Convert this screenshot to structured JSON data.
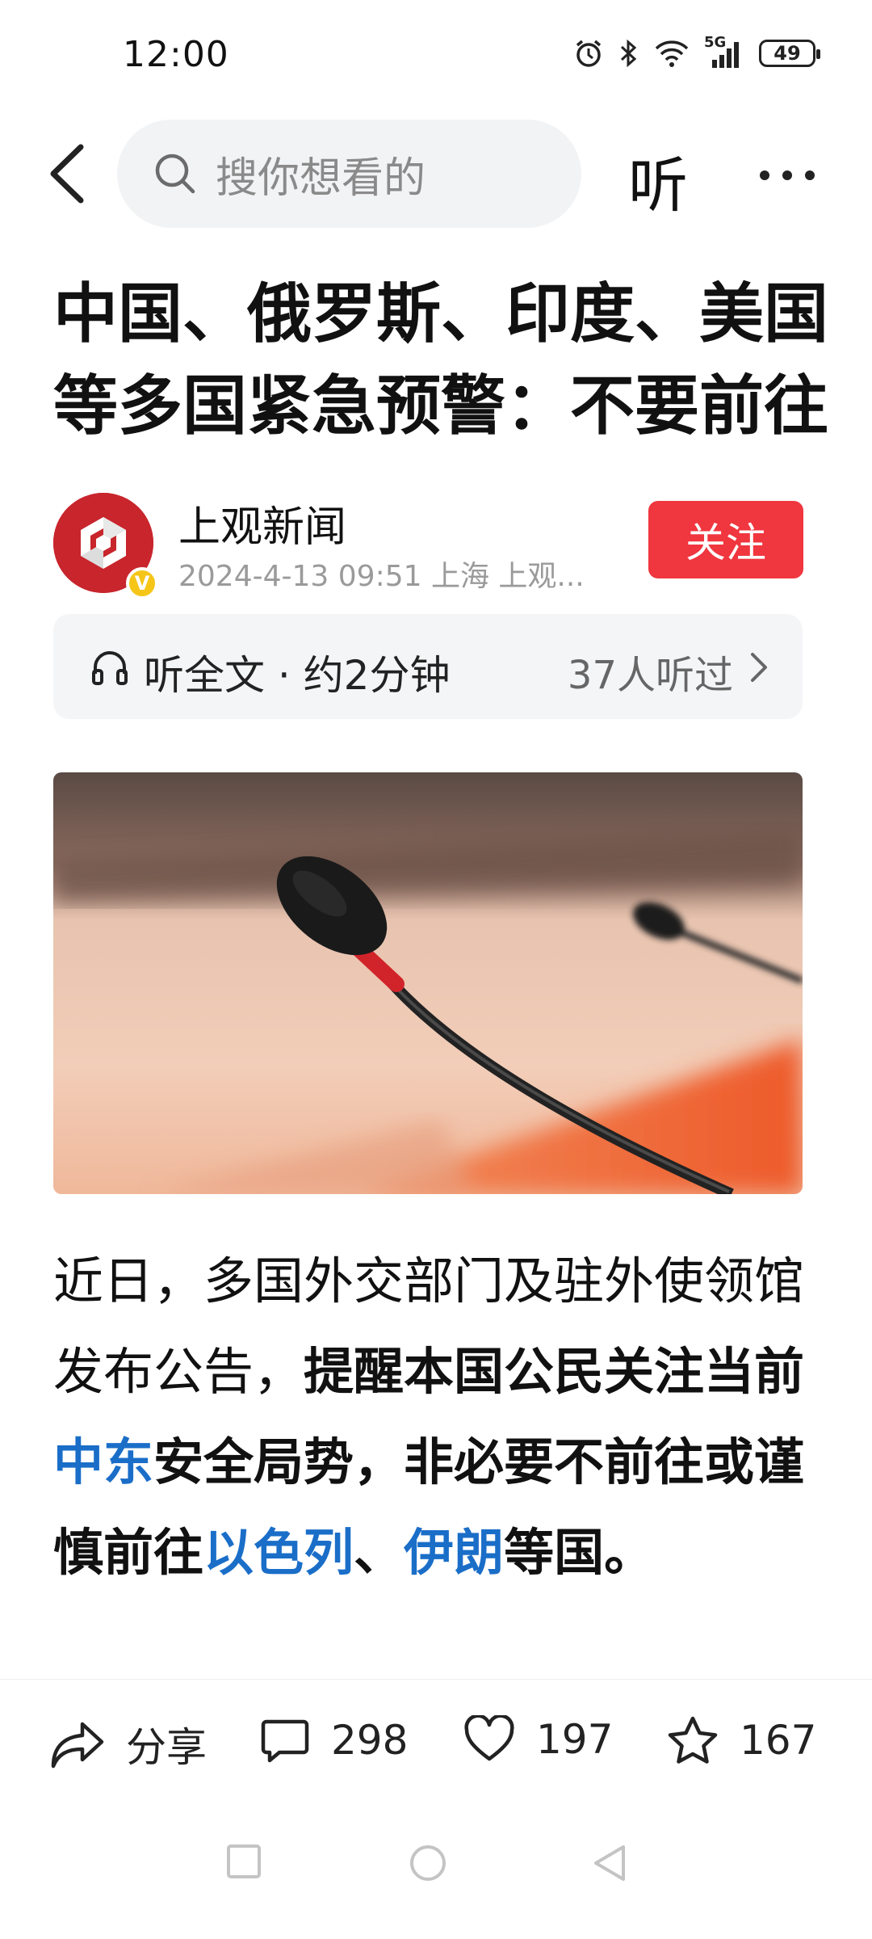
{
  "status_bar": {
    "time": "12:00",
    "network": "5G",
    "battery": "49"
  },
  "top_bar": {
    "search_placeholder": "搜你想看的",
    "listen_label": "听"
  },
  "article": {
    "title": "中国、俄罗斯、印度、美国等多国紧急预警：不要前往",
    "author": {
      "name": "上观新闻",
      "meta": "2024-4-13  09:51  上海  上观..."
    },
    "follow_label": "关注",
    "listen_bar": {
      "label": "听全文 · 约2分钟",
      "count": "37人听过"
    },
    "body": {
      "p1_plain": "近日，多国外交部门及驻外使领馆发布公告，",
      "p1_bold_a": "提醒本国公民关注当前",
      "p1_link_a": "中东",
      "p1_bold_b": "安全局势，非必要不前往或谨慎前往",
      "p1_link_b": "以色列",
      "p1_bold_c": "、",
      "p1_link_c": "伊朗",
      "p1_bold_d": "等国。"
    }
  },
  "actions": {
    "share_label": "分享",
    "comments": "298",
    "likes": "197",
    "favorites": "167"
  },
  "colors": {
    "accent_red": "#f0363e",
    "link_blue": "#1a6ec8"
  }
}
